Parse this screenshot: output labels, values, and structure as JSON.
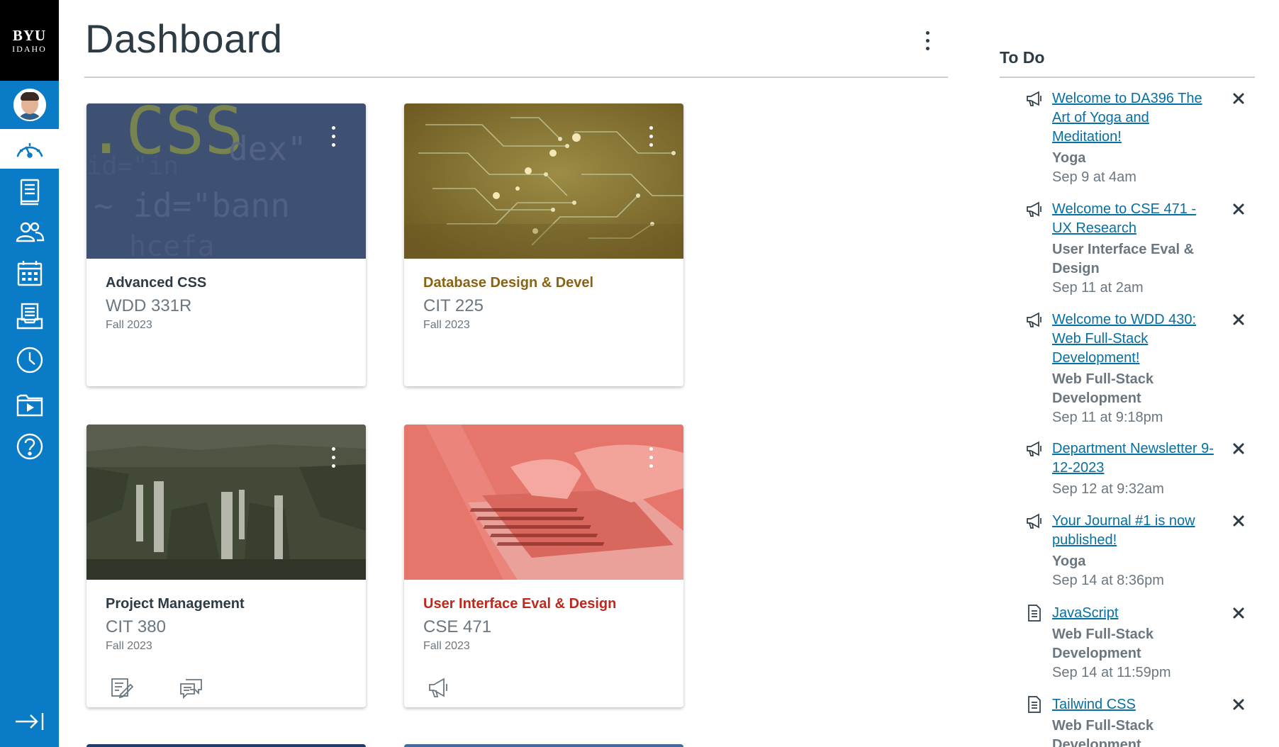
{
  "brand": {
    "line1": "BYU",
    "line2": "IDAHO"
  },
  "nav": {
    "items": [
      {
        "name": "account-avatar",
        "icon": "user-avatar"
      },
      {
        "name": "dashboard",
        "icon": "speedometer-icon",
        "active": true
      },
      {
        "name": "courses",
        "icon": "book-icon"
      },
      {
        "name": "groups",
        "icon": "people-icon"
      },
      {
        "name": "calendar",
        "icon": "calendar-icon"
      },
      {
        "name": "inbox",
        "icon": "inbox-icon"
      },
      {
        "name": "history",
        "icon": "clock-icon"
      },
      {
        "name": "studio",
        "icon": "video-folder-icon"
      },
      {
        "name": "help",
        "icon": "help-circle-icon"
      }
    ],
    "collapse_icon": "collapse-arrow-icon"
  },
  "page": {
    "title": "Dashboard"
  },
  "cards": [
    {
      "name": "Advanced CSS",
      "code": "WDD 331R",
      "term": "Fall 2023",
      "color": "#2d3b45",
      "hero": "code-slate"
    },
    {
      "name": "Database Design & Devel",
      "code": "CIT 225",
      "term": "Fall 2023",
      "color": "#8a6312",
      "hero": "circuit-gold"
    },
    {
      "name": "Project Management",
      "code": "CIT 380",
      "term": "Fall 2023",
      "color": "#2d3b45",
      "hero": "waterfall"
    },
    {
      "name": "User Interface Eval & Design",
      "code": "CSE 471",
      "term": "Fall 2023",
      "color": "#c0281d",
      "hero": "laptop-red"
    }
  ],
  "todo": {
    "heading": "To Do",
    "items": [
      {
        "icon": "announcement-icon",
        "title": "Welcome to DA396 The Art of Yoga and Meditation!",
        "course": "Yoga",
        "date": "Sep 9 at 4am"
      },
      {
        "icon": "announcement-icon",
        "title": "Welcome to CSE 471 - UX Research",
        "course": "User Interface Eval & Design",
        "date": "Sep 11 at 2am"
      },
      {
        "icon": "announcement-icon",
        "title": "Welcome to WDD 430: Web Full-Stack Development!",
        "course": "Web Full-Stack Development",
        "date": "Sep 11 at 9:18pm"
      },
      {
        "icon": "announcement-icon",
        "title": "Department Newsletter 9-12-2023",
        "course": "",
        "date": "Sep 12 at 9:32am"
      },
      {
        "icon": "announcement-icon",
        "title": "Your Journal #1 is now published!",
        "course": "Yoga",
        "date": "Sep 14 at 8:36pm"
      },
      {
        "icon": "page-icon",
        "title": "JavaScript",
        "course": "Web Full-Stack Development",
        "date": "Sep 14 at 11:59pm"
      },
      {
        "icon": "page-icon",
        "title": "Tailwind CSS",
        "course": "Web Full-Stack Development",
        "date": ""
      }
    ]
  }
}
